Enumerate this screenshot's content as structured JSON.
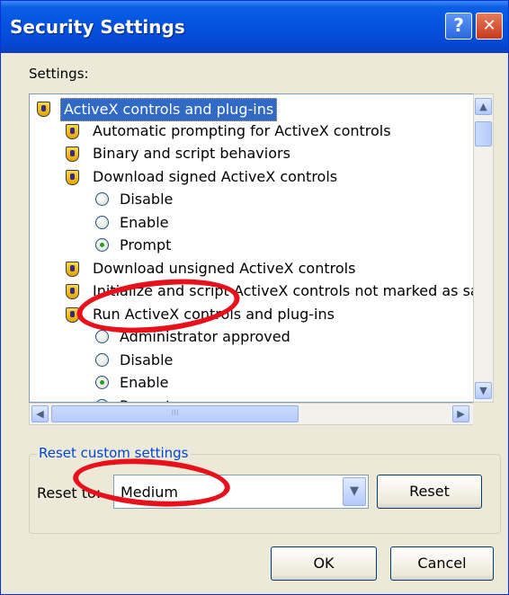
{
  "window": {
    "title": "Security Settings",
    "help_label": "?",
    "close_label": "✕"
  },
  "settings_label": "Settings:",
  "tree": {
    "items": [
      {
        "type": "group",
        "label": "ActiveX controls and plug-ins"
      },
      {
        "type": "setting",
        "label": "Automatic prompting for ActiveX controls"
      },
      {
        "type": "setting",
        "label": "Binary and script behaviors"
      },
      {
        "type": "setting",
        "label": "Download signed ActiveX controls"
      },
      {
        "type": "option",
        "label": "Disable",
        "checked": false
      },
      {
        "type": "option",
        "label": "Enable",
        "checked": false
      },
      {
        "type": "option",
        "label": "Prompt",
        "checked": true
      },
      {
        "type": "setting",
        "label": "Download unsigned ActiveX controls"
      },
      {
        "type": "setting",
        "label": "Initialize and script ActiveX controls not marked as safe"
      },
      {
        "type": "setting",
        "label": "Run ActiveX controls and plug-ins"
      },
      {
        "type": "option",
        "label": "Administrator approved",
        "checked": false
      },
      {
        "type": "option",
        "label": "Disable",
        "checked": false
      },
      {
        "type": "option",
        "label": "Enable",
        "checked": true
      },
      {
        "type": "option",
        "label": "Prompt",
        "checked": false
      }
    ]
  },
  "scrollbar": {
    "up": "▲",
    "down": "▼",
    "left": "◀",
    "right": "▶",
    "grip": "III"
  },
  "reset_group": {
    "title": "Reset custom settings",
    "reset_to_label": "Reset to:",
    "selected": "Medium",
    "dropdown_arrow": "▼",
    "reset_button": "Reset"
  },
  "buttons": {
    "ok": "OK",
    "cancel": "Cancel"
  },
  "colors": {
    "titlebar": "#0453e0",
    "annotation": "#e8101a",
    "group_label": "#0046d5",
    "selection": "#316ac5"
  }
}
